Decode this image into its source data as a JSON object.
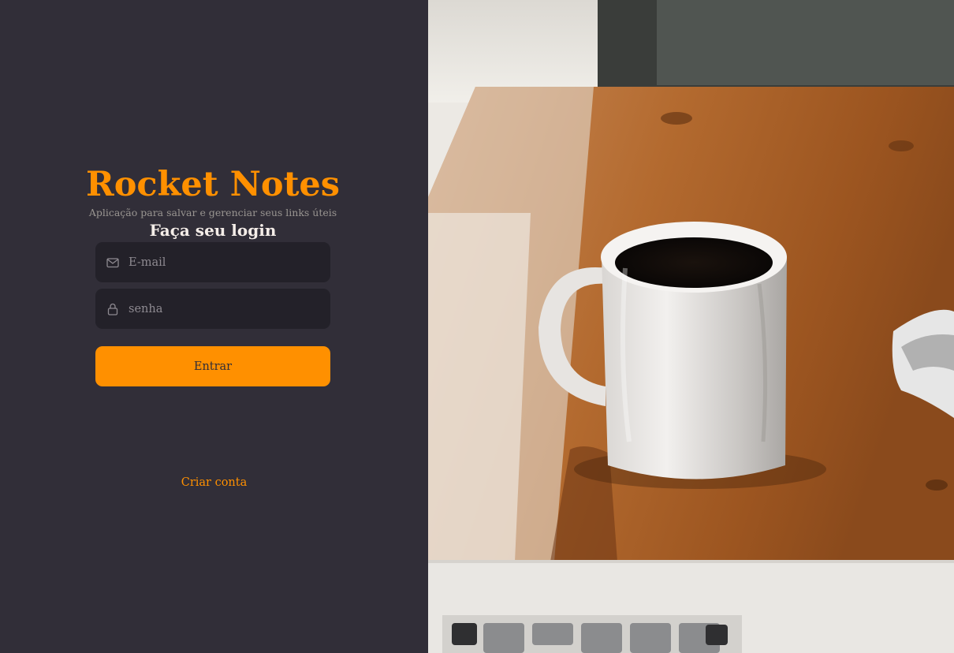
{
  "app": {
    "title": "Rocket Notes",
    "subtitle": "Aplicação para salvar e gerenciar seus links úteis"
  },
  "form": {
    "heading": "Faça seu login",
    "email_placeholder": "E-mail",
    "password_placeholder": "senha",
    "submit_label": "Entrar",
    "create_account_label": "Criar conta"
  },
  "icons": {
    "email": "mail-icon",
    "password": "lock-icon"
  },
  "colors": {
    "background": "#312e38",
    "input_background": "#232129",
    "accent": "#ff9000",
    "heading_text": "#f4ede8",
    "muted_text": "#999591"
  }
}
